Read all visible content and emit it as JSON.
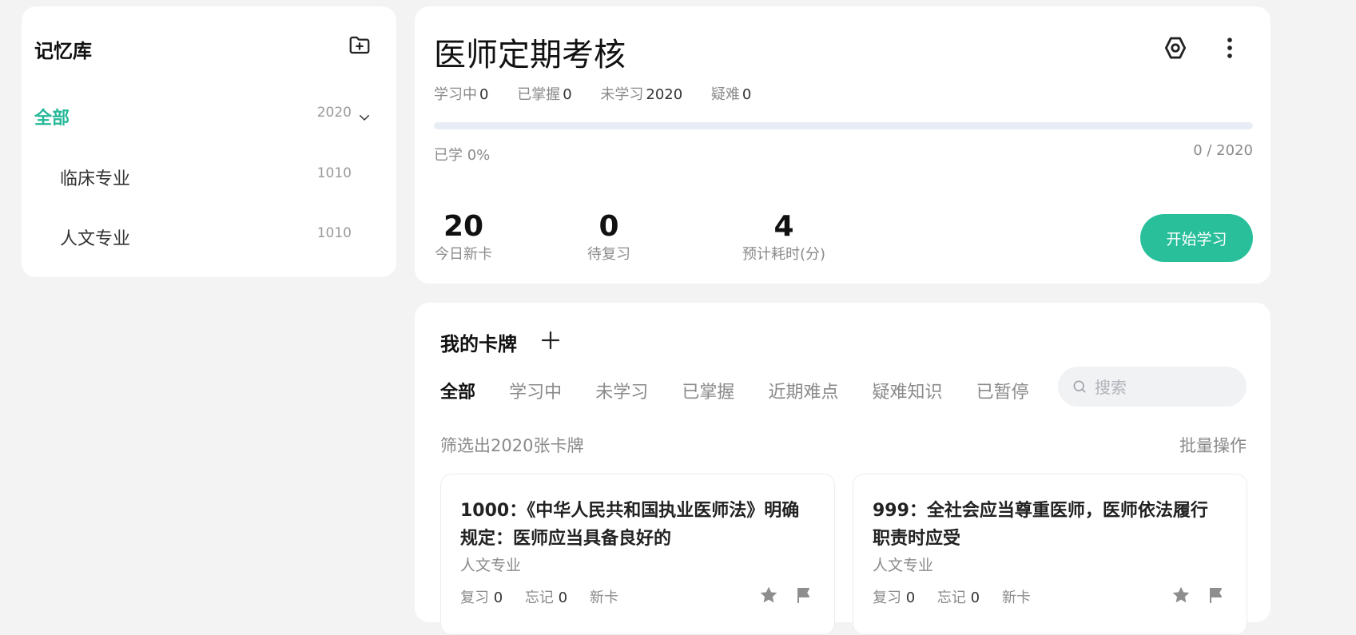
{
  "sidebar": {
    "title": "记忆库",
    "items": [
      {
        "label": "全部",
        "count": "2020"
      },
      {
        "label": "临床专业",
        "count": "1010"
      },
      {
        "label": "人文专业",
        "count": "1010"
      }
    ]
  },
  "deck": {
    "title": "医师定期考核",
    "stats": [
      {
        "label": "学习中",
        "value": "0"
      },
      {
        "label": "已掌握",
        "value": "0"
      },
      {
        "label": "未学习",
        "value": "2020"
      },
      {
        "label": "疑难",
        "value": "0"
      }
    ],
    "progress_fraction": 0,
    "learned_text": "已学 0%",
    "ratio_text": "0 / 2020",
    "today_new": {
      "value": "20",
      "label": "今日新卡"
    },
    "to_review": {
      "value": "0",
      "label": "待复习"
    },
    "est_time": {
      "value": "4",
      "label": "预计耗时(分)"
    },
    "start_label": "开始学习",
    "accent_color": "#29bf9b"
  },
  "cards_panel": {
    "title": "我的卡牌",
    "tabs": [
      "全部",
      "学习中",
      "未学习",
      "已掌握",
      "近期难点",
      "疑难知识",
      "已暂停"
    ],
    "search_placeholder": "搜索",
    "filtered_text": "筛选出2020张卡牌",
    "batch_label": "批量操作",
    "cards": [
      {
        "title": "1000：《中华人民共和国执业医师法》明确规定：医师应当具备良好的",
        "deck": "人文专业",
        "review_label": "复习",
        "review_value": "0",
        "forget_label": "忘记",
        "forget_value": "0",
        "status": "新卡"
      },
      {
        "title": "999：全社会应当尊重医师，医师依法履行职责时应受",
        "deck": "人文专业",
        "review_label": "复习",
        "review_value": "0",
        "forget_label": "忘记",
        "forget_value": "0",
        "status": "新卡"
      }
    ]
  },
  "icons": {
    "new_deck": "folder-plus-icon",
    "chevron": "chevron-down-icon",
    "settings": "hexagon-settings-icon",
    "more": "more-vertical-icon",
    "add_card": "plus-icon",
    "search": "search-icon",
    "star": "star-icon",
    "flag": "flag-icon"
  }
}
